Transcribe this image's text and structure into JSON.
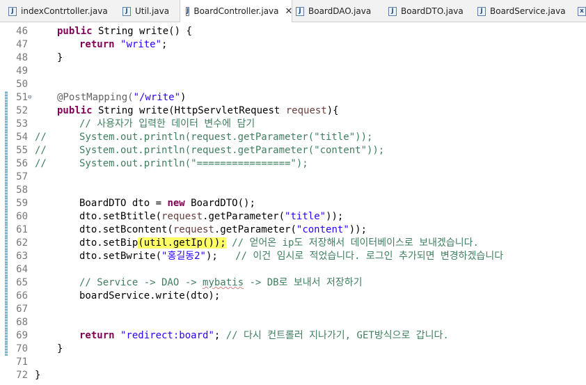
{
  "tabs": [
    {
      "label": "indexContrtoller.java",
      "icon": "java-file-icon",
      "active": false
    },
    {
      "label": "Util.java",
      "icon": "java-file-icon",
      "active": false
    },
    {
      "label": "BoardController.java",
      "icon": "java-file-icon",
      "active": true,
      "close": "✕"
    },
    {
      "label": "BoardDAO.java",
      "icon": "java-file-icon",
      "active": false
    },
    {
      "label": "BoardDTO.java",
      "icon": "java-file-icon",
      "active": false
    },
    {
      "label": "BoardService.java",
      "icon": "java-file-icon",
      "active": false
    }
  ],
  "code": {
    "l46": {
      "num": "46",
      "kw": "public",
      "text": " String write() {"
    },
    "l47": {
      "num": "47",
      "kw": "return",
      "str": "\"write\"",
      "end": ";"
    },
    "l48": {
      "num": "48",
      "text": "}"
    },
    "l49": {
      "num": "49"
    },
    "l50": {
      "num": "50"
    },
    "l51": {
      "num": "51",
      "ann": "@PostMapping(",
      "str": "\"/write\"",
      "end": ")"
    },
    "l52": {
      "num": "52",
      "kw": "public",
      "text": " String write(HttpServletRequest ",
      "param": "request",
      "end": "){"
    },
    "l53": {
      "num": "53",
      "comment": "// 사용자가 입력한 데이터 변수에 담기"
    },
    "l54": {
      "num": "54",
      "mark": "//",
      "text": "System.out.println(request.getParameter(\"title\"));"
    },
    "l55": {
      "num": "55",
      "mark": "//",
      "text": "System.out.println(request.getParameter(\"content\"));"
    },
    "l56": {
      "num": "56",
      "mark": "//",
      "text": "System.out.println(\"================\");"
    },
    "l57": {
      "num": "57"
    },
    "l58": {
      "num": "58"
    },
    "l59": {
      "num": "59",
      "a": "BoardDTO dto = ",
      "kw": "new",
      "b": " BoardDTO();"
    },
    "l60": {
      "num": "60",
      "a": "dto.setBtitle(",
      "b": "request",
      "c": ".getParameter(",
      "str": "\"title\"",
      "end": "));"
    },
    "l61": {
      "num": "61",
      "a": "dto.setBcontent(",
      "b": "request",
      "c": ".getParameter(",
      "str": "\"content\"",
      "end": "));"
    },
    "l62": {
      "num": "62",
      "a": "dto.setBip",
      "hl": "(util.getIp());",
      "comment": " // 얻어온 ip도 저장해서 데이터베이스로 보내겠습니다."
    },
    "l63": {
      "num": "63",
      "a": "dto.setBwrite(",
      "str": "\"홍길동2\"",
      "end": ");",
      "comment": "   // 이건 임시로 적었습니다. 로그인 추가되면 변경하겠습니다"
    },
    "l64": {
      "num": "64"
    },
    "l65": {
      "num": "65",
      "comment_a": "// Service -> DAO -> ",
      "comment_sq": "mybatis",
      "comment_b": " -> DB로 보내서 저장하기"
    },
    "l66": {
      "num": "66",
      "text": "boardService.write(dto);"
    },
    "l67": {
      "num": "67"
    },
    "l68": {
      "num": "68"
    },
    "l69": {
      "num": "69",
      "kw": "return",
      "str": " \"redirect:board\"",
      "end": ";",
      "comment": " // 다시 컨트롤러 지나가기, GET방식으로 갑니다."
    },
    "l70": {
      "num": "70",
      "text": "}"
    },
    "l71": {
      "num": "71"
    },
    "l72": {
      "num": "72",
      "text": "}"
    }
  }
}
